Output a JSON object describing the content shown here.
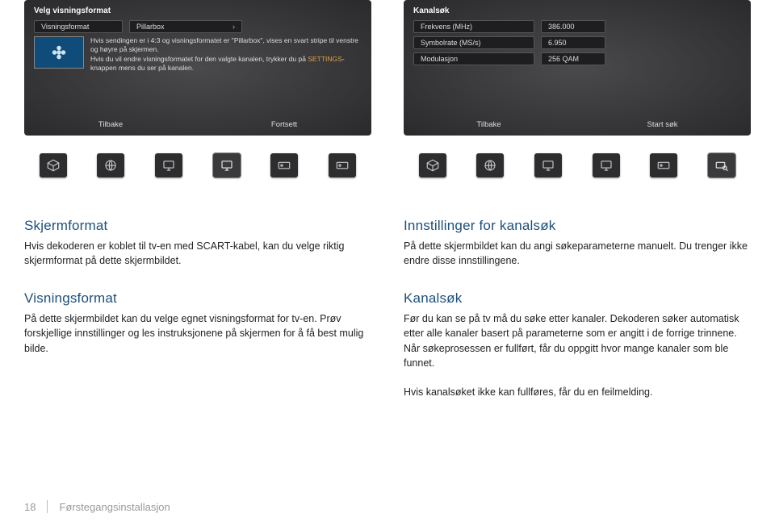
{
  "panel_left": {
    "title": "Velg visningsformat",
    "label_left": "Visningsformat",
    "label_right": "Pillarbox",
    "desc1_a": "Hvis sendingen er i 4:3 og visningsformatet er \"Pillarbox\", vises en svart stripe til venstre og høyre på skjermen.",
    "desc2_a": "Hvis du vil endre visningsformatet for den valgte kanalen, trykker du på ",
    "desc2_hl": "SETTINGS",
    "desc2_b": "-knappen mens du ser på kanalen.",
    "btn_left": "Tilbake",
    "btn_right": "Fortsett"
  },
  "panel_right": {
    "title": "Kanalsøk",
    "rows": [
      {
        "k": "Frekvens (MHz)",
        "v": "386.000"
      },
      {
        "k": "Symbolrate (MS/s)",
        "v": "6.950"
      },
      {
        "k": "Modulasjon",
        "v": "256 QAM"
      }
    ],
    "btn_left": "Tilbake",
    "btn_right": "Start søk"
  },
  "icons": {
    "left": [
      "box-icon",
      "globe-icon",
      "monitor-icon",
      "monitor-icon",
      "card-icon",
      "card-icon"
    ],
    "right": [
      "box-icon",
      "globe-icon",
      "monitor-icon",
      "monitor-icon",
      "card-icon",
      "search-icon"
    ]
  },
  "sections": {
    "l1_title": "Skjermformat",
    "l1_body": "Hvis dekoderen er koblet til tv-en med SCART-kabel, kan du velge riktig skjermformat på dette skjermbildet.",
    "l2_title": "Visningsformat",
    "l2_body": "På dette skjermbildet kan du velge egnet visningsformat for tv-en. Prøv forskjellige innstillinger og les instruksjonene på skjermen for å få best mulig bilde.",
    "r1_title": "Innstillinger for kanalsøk",
    "r1_body": "På dette skjermbildet kan du angi søkeparameterne manuelt. Du trenger ikke endre disse innstillingene.",
    "r2_title": "Kanalsøk",
    "r2_body_a": "Før du kan se på tv må du søke etter kanaler. Dekoderen søker automatisk etter alle kanaler basert på parameterne som er angitt i de forrige trinnene. Når søkeprosessen er fullført, får du oppgitt hvor mange kanaler som ble funnet.",
    "r2_body_b": "Hvis kanalsøket ikke kan fullføres, får du en feilmelding."
  },
  "footer": {
    "page": "18",
    "section": "Førstegangsinstallasjon"
  }
}
